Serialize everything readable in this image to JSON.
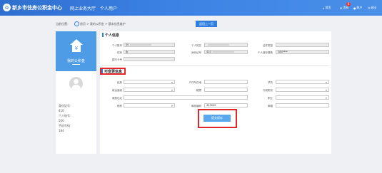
{
  "header": {
    "title": "新乡市住房公积金中心",
    "nav": [
      "网上业务大厅",
      "个人用户"
    ],
    "home": "首页",
    "message": "消息",
    "message_count": "4",
    "account": "账户",
    "exit": "退出"
  },
  "breadcrumb": {
    "label": "当前位置：",
    "path": "首页 > 我的公积金 > 基本信息维护",
    "back_button": "返回上一页"
  },
  "left_panel": {
    "title": "我的公积金",
    "info": [
      "身份证号：",
      "410",
      "个人账号：",
      "500",
      "手机号码：",
      "184"
    ]
  },
  "personal_info": {
    "title": "个人信息",
    "fields": [
      {
        "label": "个人账号",
        "value": "50"
      },
      {
        "label": "个人姓名",
        "value": ""
      },
      {
        "label": "证件类型",
        "value": ""
      },
      {
        "label": "性别",
        "value": "女"
      },
      {
        "label": "身份证号",
        "value": "410"
      },
      {
        "label": "个人缴存基数",
        "value": "184****"
      },
      {
        "label": "银行卡号",
        "value": ""
      }
    ]
  },
  "editable_info": {
    "title": "可变更信息",
    "fields": [
      {
        "label": "民族",
        "value": ""
      },
      {
        "label": "户口所在地",
        "value": ""
      },
      {
        "label": "学历",
        "value": ""
      },
      {
        "label": "政治面貌",
        "value": ""
      },
      {
        "label": "籍贯",
        "value": ""
      },
      {
        "label": "行政职务",
        "value": ""
      },
      {
        "label": "家庭住址",
        "value": ""
      },
      {
        "label": "职业",
        "value": ""
      },
      {
        "label": "职称",
        "value": ""
      },
      {
        "label": "邮政编码",
        "value": "453000"
      },
      {
        "label": "邮箱",
        "value": ""
      }
    ],
    "submit": "提交保存"
  }
}
